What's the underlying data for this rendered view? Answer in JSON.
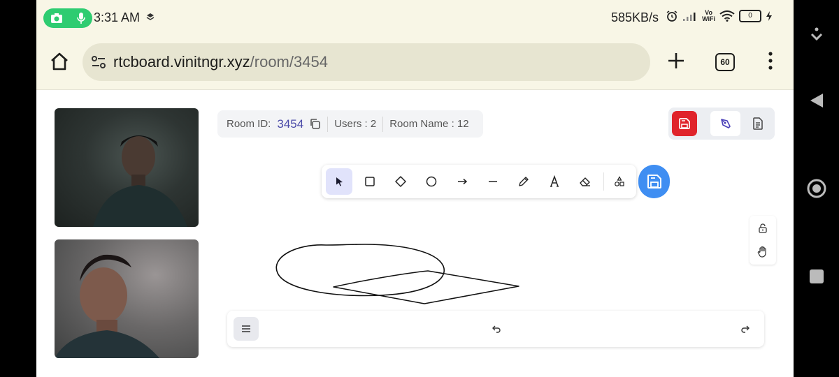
{
  "status_bar": {
    "time": "3:31 AM",
    "net_speed": "585KB/s",
    "vowifi_top": "Vo",
    "vowifi_bottom": "WiFi",
    "battery": "0"
  },
  "browser": {
    "url_host": "rtcboard.vinitngr.xyz",
    "url_path": "/room/3454",
    "tab_count": "60"
  },
  "room": {
    "id_label": "Room ID:",
    "id_value": "3454",
    "users": "Users : 2",
    "room_name": "Room Name : 12"
  },
  "toolbar": {
    "tools": [
      "select",
      "rectangle",
      "diamond",
      "ellipse",
      "arrow",
      "line",
      "draw",
      "text",
      "eraser",
      "more-shapes"
    ],
    "active_tool": "select"
  },
  "colors": {
    "accent": "#3f8ef2",
    "danger": "#e0242b",
    "active_tool_bg": "#e1e3fb",
    "recording_pill": "#2ecc71"
  }
}
